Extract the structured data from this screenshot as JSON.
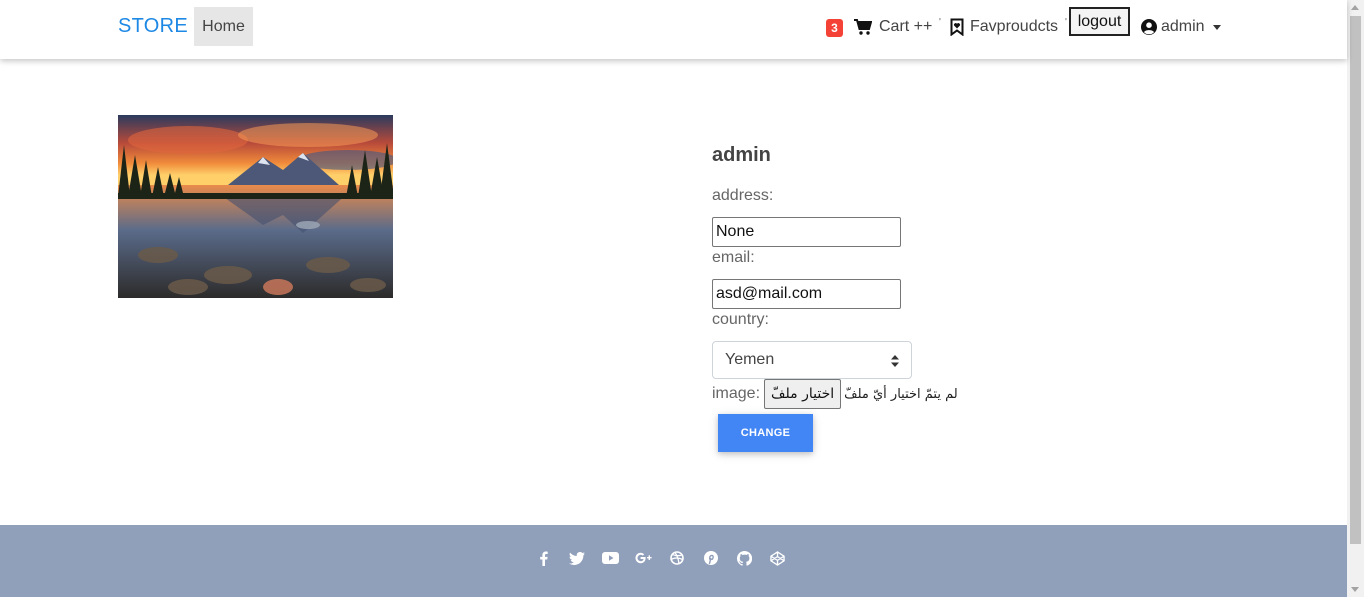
{
  "navbar": {
    "brand": "STORE",
    "home": "Home",
    "cart_count": "3",
    "cart": "Cart ++",
    "favorites": "Favproudcts",
    "logout": "logout",
    "user": "admin",
    "separator": "'"
  },
  "profile": {
    "username": "admin",
    "address_label": "address:",
    "address_value": "None",
    "email_label": "email:",
    "email_value": "asd@mail.com",
    "country_label": "country:",
    "country_value": "Yemen",
    "image_label": "image:",
    "file_button": "اختيار ملفّ",
    "file_status": "لم يتمّ اختيار أيّ ملفّ",
    "change_button": "CHANGE"
  },
  "colors": {
    "brand": "#1e88e5",
    "badge": "#f44336",
    "primary_button": "#4285f4",
    "footer": "#909fba"
  },
  "footer": {
    "icons": [
      "facebook-icon",
      "twitter-icon",
      "youtube-icon",
      "google-plus-icon",
      "dribbble-icon",
      "pinterest-icon",
      "github-icon",
      "codepen-icon"
    ]
  }
}
